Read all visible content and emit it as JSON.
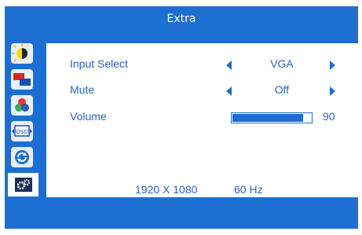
{
  "osd": {
    "title": "Extra",
    "sidebar": [
      {
        "name": "brightness-contrast-icon"
      },
      {
        "name": "image-setup-icon"
      },
      {
        "name": "color-icon"
      },
      {
        "name": "osd-icon"
      },
      {
        "name": "reset-icon"
      },
      {
        "name": "extra-settings-icon",
        "active": true
      }
    ],
    "rows": [
      {
        "label": "Input Select",
        "value": "VGA"
      },
      {
        "label": "Mute",
        "value": "Off"
      },
      {
        "label": "Volume",
        "value": "90",
        "level": 0.9
      }
    ],
    "status": {
      "resolution": "1920 X 1080",
      "refresh": "60 Hz"
    },
    "colors": {
      "accent": "#1c6fd0",
      "text": "#2a63c4",
      "panel": "#ffffff"
    }
  }
}
